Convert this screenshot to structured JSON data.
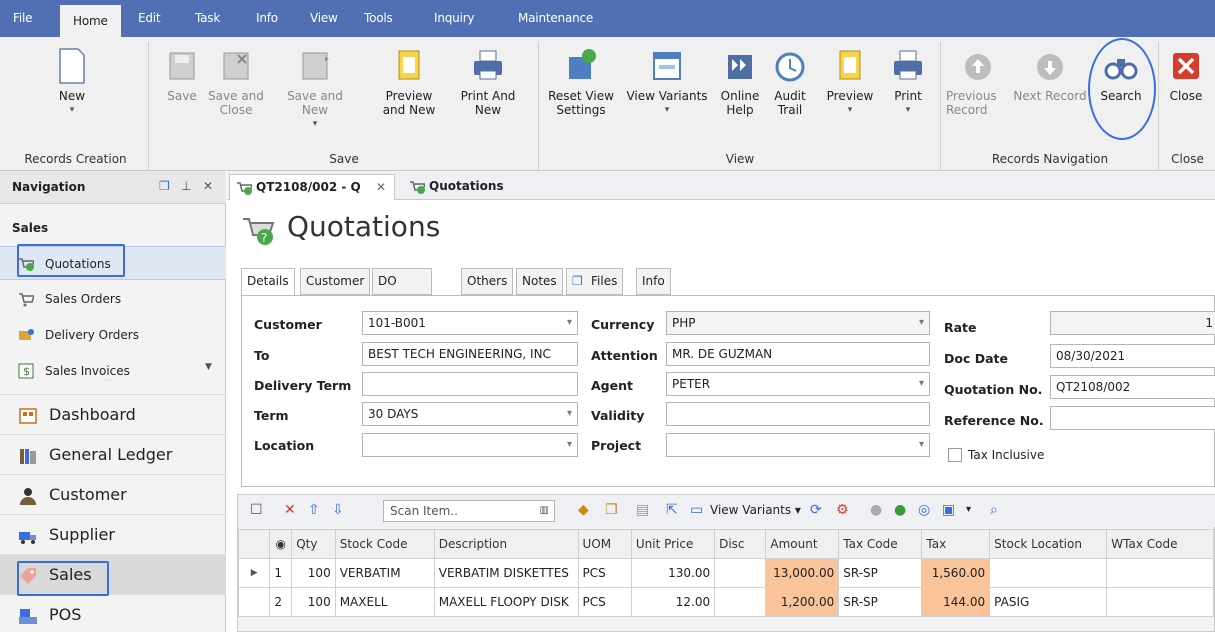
{
  "menu_tabs": [
    "File",
    "Home",
    "Edit",
    "Task",
    "Info",
    "View",
    "Tools",
    "Inquiry",
    "Maintenance"
  ],
  "ribbon": {
    "new": "New",
    "save": "Save",
    "save_close": "Save and Close",
    "save_new": "Save and New",
    "preview_new": "Preview and New",
    "print_new": "Print And New",
    "reset_view": "Reset View Settings",
    "view_variants": "View Variants",
    "online_help": "Online Help",
    "audit_trail": "Audit Trail",
    "preview": "Preview",
    "print": "Print",
    "prev_record": "Previous Record",
    "next_record": "Next Record",
    "search": "Search",
    "close": "Close",
    "groups": {
      "records_creation": "Records Creation",
      "save": "Save",
      "view": "View",
      "records_navigation": "Records Navigation",
      "close": "Close"
    }
  },
  "nav": {
    "title": "Navigation",
    "section": "Sales",
    "items": [
      "Quotations",
      "Sales Orders",
      "Delivery Orders",
      "Sales Invoices"
    ],
    "modules": [
      "Dashboard",
      "General Ledger",
      "Customer",
      "Supplier",
      "Sales",
      "POS"
    ]
  },
  "doc_tabs": [
    "QT2108/002 - Q",
    "Quotations"
  ],
  "page_title": "Quotations",
  "form_tabs": [
    "Details",
    "Customer",
    "DO Address",
    "Others",
    "Notes",
    "Files",
    "Info"
  ],
  "form": {
    "customer_label": "Customer",
    "customer": "101-B001",
    "to_label": "To",
    "to": "BEST TECH ENGINEERING, INC",
    "delivery_term_label": "Delivery Term",
    "delivery_term": "",
    "term_label": "Term",
    "term": "30 DAYS",
    "location_label": "Location",
    "location": "",
    "currency_label": "Currency",
    "currency": "PHP",
    "attention_label": "Attention",
    "attention": "MR. DE GUZMAN",
    "agent_label": "Agent",
    "agent": "PETER",
    "validity_label": "Validity",
    "validity": "",
    "project_label": "Project",
    "project": "",
    "rate_label": "Rate",
    "rate": "1",
    "doc_date_label": "Doc Date",
    "doc_date": "08/30/2021",
    "quotation_no_label": "Quotation No.",
    "quotation_no": "QT2108/002",
    "reference_no_label": "Reference No.",
    "reference_no": "",
    "tax_inclusive_label": "Tax Inclusive"
  },
  "grid": {
    "scan_placeholder": "Scan Item..",
    "view_variants": "View Variants",
    "columns": [
      "Qty",
      "Stock Code",
      "Description",
      "UOM",
      "Unit Price",
      "Disc",
      "Amount",
      "Tax Code",
      "Tax",
      "Stock Location",
      "WTax Code"
    ],
    "rows": [
      {
        "no": "1",
        "qty": "100",
        "code": "VERBATIM",
        "desc": "VERBATIM DISKETTES",
        "uom": "PCS",
        "price": "130.00",
        "disc": "",
        "amount": "13,000.00",
        "taxcode": "SR-SP",
        "tax": "1,560.00",
        "loc": "",
        "wtax": ""
      },
      {
        "no": "2",
        "qty": "100",
        "code": "MAXELL",
        "desc": "MAXELL FLOOPY DISK",
        "uom": "PCS",
        "price": "12.00",
        "disc": "",
        "amount": "1,200.00",
        "taxcode": "SR-SP",
        "tax": "144.00",
        "loc": "PASIG",
        "wtax": ""
      }
    ]
  }
}
